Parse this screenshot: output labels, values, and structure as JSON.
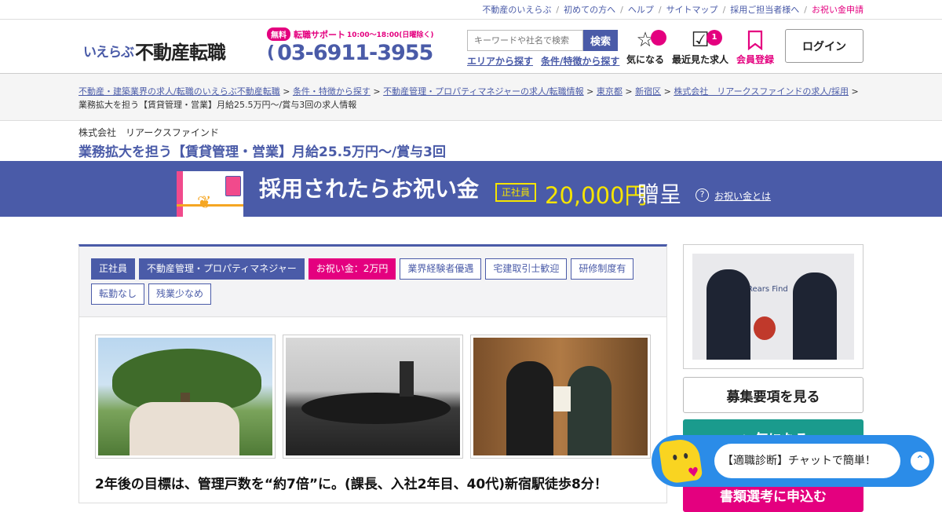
{
  "topnav": [
    "不動産のいえらぶ",
    "初めての方へ",
    "ヘルプ",
    "サイトマップ",
    "採用ご担当者様へ",
    "お祝い金申請"
  ],
  "logo": {
    "brand": "いえらぶ",
    "main": "不動産転職"
  },
  "support": {
    "free": "無料",
    "label": "転職サポート",
    "hours": "10:00〜18:00(日曜除く)",
    "phone": "03-6911-3955"
  },
  "search": {
    "placeholder": "キーワードや社名で検索",
    "button": "検索",
    "link_area": "エリアから探す",
    "link_cond": "条件/特徴から探す"
  },
  "header_icons": {
    "fav": "気になる",
    "recent": "最近見た求人",
    "recent_count": "1",
    "register": "会員登録"
  },
  "login": "ログイン",
  "breadcrumb": {
    "c1": "不動産・建築業界の求人/転職のいえらぶ不動産転職",
    "c2": "条件・特徴から探す",
    "c3": "不動産管理・プロパティマネジャーの求人/転職情報",
    "c4": "東京都",
    "c5": "新宿区",
    "c6": "株式会社　リアークスファインドの求人/採用",
    "tail": "業務拡大を担う【賃貸管理・営業】月給25.5万円～/賞与3回の求人情報"
  },
  "company": "株式会社　リアークスファインド",
  "job_title": "業務拡大を担う【賃貸管理・営業】月給25.5万円～/賞与3回",
  "banner": {
    "message": "採用されたらお祝い金",
    "employment": "正社員",
    "amount": "20,000円",
    "suffix": "贈呈",
    "help_link": "お祝い金とは"
  },
  "tags": [
    {
      "label": "正社員",
      "style": "fill"
    },
    {
      "label": "不動産管理・プロパティマネジャー",
      "style": "fill"
    },
    {
      "label": "お祝い金：2万円",
      "style": "pink"
    },
    {
      "label": "業界経験者優遇",
      "style": "outline"
    },
    {
      "label": "宅建取引士歓迎",
      "style": "outline"
    },
    {
      "label": "研修制度有",
      "style": "outline"
    },
    {
      "label": "転勤なし",
      "style": "outline"
    },
    {
      "label": "残業少なめ",
      "style": "outline"
    }
  ],
  "catchcopy": "2年後の目標は、管理戸数を“約7倍”に。(課長、入社2年目、40代)新宿駅徒歩8分！",
  "side": {
    "btn_details": "募集要項を見る",
    "btn_fav": "☆ 気になる",
    "btn_apply": "書類選考に申込む",
    "office_sign": "Rears Find"
  },
  "chat": {
    "text": "【適職診断】チャットで簡単！"
  },
  "colors": {
    "primary": "#4a5ba8",
    "accent": "#e4007f",
    "teal": "#1a9b8d",
    "chat": "#2b8ce8",
    "yellow": "#f5e400"
  }
}
